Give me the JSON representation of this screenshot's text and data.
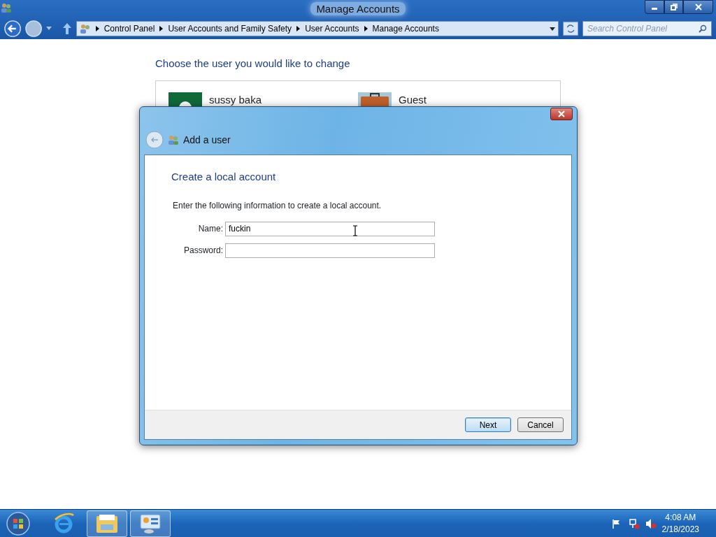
{
  "window": {
    "title": "Manage Accounts"
  },
  "address": {
    "crumbs": [
      "Control Panel",
      "User Accounts and Family Safety",
      "User Accounts",
      "Manage Accounts"
    ]
  },
  "search": {
    "placeholder": "Search Control Panel"
  },
  "heading": "Choose the user you would like to change",
  "users": [
    {
      "name": "sussy baka",
      "kind": "person"
    },
    {
      "name": "Guest",
      "kind": "guest"
    }
  ],
  "dialog": {
    "title": "Add a user",
    "heading": "Create a local account",
    "instruction": "Enter the following information to create a local account.",
    "fields": [
      {
        "label": "Name:",
        "value": "fuckin",
        "kind": "text"
      },
      {
        "label": "Password:",
        "kind": "password"
      }
    ],
    "buttons": [
      {
        "label": "Next",
        "default": true
      },
      {
        "label": "Cancel",
        "default": false
      }
    ]
  },
  "taskbar": {
    "apps": [
      {
        "kind": "browser",
        "running": false
      },
      {
        "kind": "explorer",
        "running": true
      },
      {
        "kind": "control-panel",
        "running": true
      }
    ],
    "time": "4:08 AM",
    "date": "2/18/2023"
  }
}
